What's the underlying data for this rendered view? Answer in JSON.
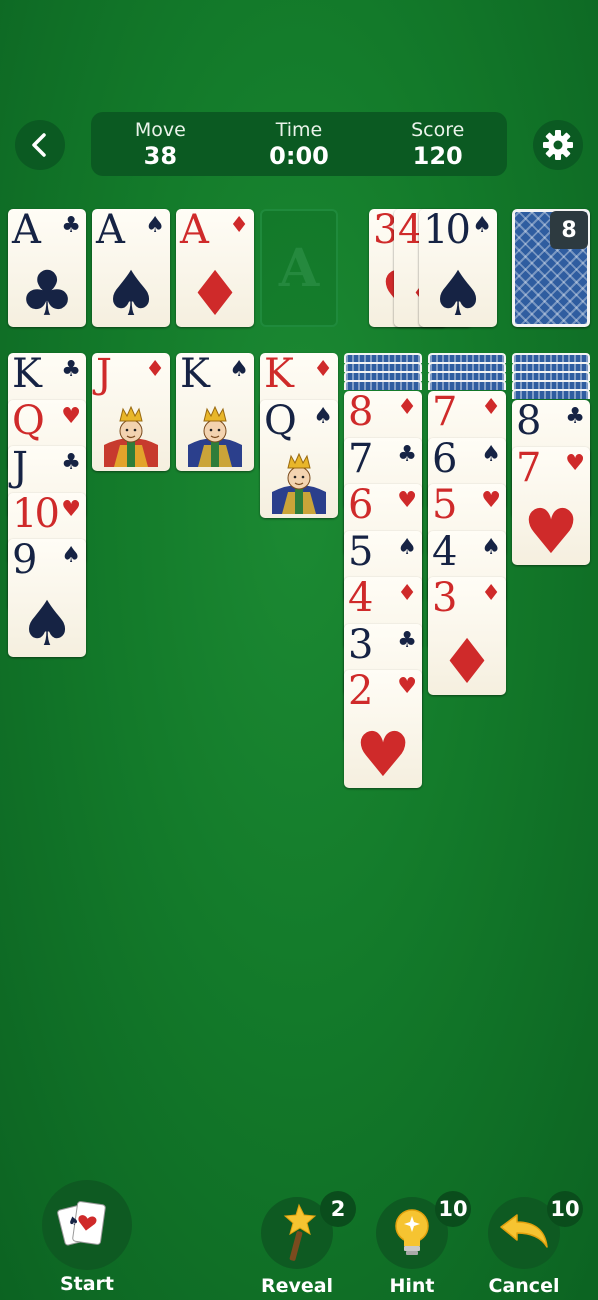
{
  "header": {
    "stats": {
      "move": {
        "label": "Move",
        "value": "38"
      },
      "time": {
        "label": "Time",
        "value": "0:00"
      },
      "score": {
        "label": "Score",
        "value": "120"
      }
    }
  },
  "foundations": [
    {
      "rank": "A",
      "suit": "♣"
    },
    {
      "rank": "A",
      "suit": "♠"
    },
    {
      "rank": "A",
      "suit": "♦"
    }
  ],
  "empty_foundation_label": "A",
  "waste": [
    {
      "rank": "3",
      "suit": "♥"
    },
    {
      "rank": "4",
      "suit": "♦"
    },
    {
      "rank": "10",
      "suit": "♠"
    }
  ],
  "stock": {
    "count": "8"
  },
  "tableau": [
    {
      "cards": [
        {
          "rank": "K",
          "suit": "♣"
        },
        {
          "rank": "Q",
          "suit": "♥"
        },
        {
          "rank": "J",
          "suit": "♣"
        },
        {
          "rank": "10",
          "suit": "♥"
        },
        {
          "rank": "9",
          "suit": "♠"
        }
      ]
    },
    {
      "cards": [
        {
          "rank": "J",
          "suit": "♦"
        }
      ]
    },
    {
      "cards": [
        {
          "rank": "K",
          "suit": "♠"
        }
      ]
    },
    {
      "cards": [
        {
          "rank": "K",
          "suit": "♦"
        },
        {
          "rank": "Q",
          "suit": "♠"
        }
      ]
    },
    {
      "cards": [
        {
          "rank": "8",
          "suit": "♦"
        },
        {
          "rank": "7",
          "suit": "♣"
        },
        {
          "rank": "6",
          "suit": "♥"
        },
        {
          "rank": "5",
          "suit": "♠"
        },
        {
          "rank": "4",
          "suit": "♦"
        },
        {
          "rank": "3",
          "suit": "♣"
        },
        {
          "rank": "2",
          "suit": "♥"
        }
      ]
    },
    {
      "cards": [
        {
          "rank": "7",
          "suit": "♦"
        },
        {
          "rank": "6",
          "suit": "♠"
        },
        {
          "rank": "5",
          "suit": "♥"
        },
        {
          "rank": "4",
          "suit": "♠"
        },
        {
          "rank": "3",
          "suit": "♦"
        }
      ]
    },
    {
      "cards": [
        {
          "rank": "8",
          "suit": "♣"
        },
        {
          "rank": "7",
          "suit": "♥"
        }
      ]
    }
  ],
  "toolbar": {
    "start": {
      "label": "Start"
    },
    "reveal": {
      "label": "Reveal",
      "badge": "2"
    },
    "hint": {
      "label": "Hint",
      "badge": "10"
    },
    "cancel": {
      "label": "Cancel",
      "badge": "10"
    }
  },
  "colors": {
    "red_suit": "#cf2a2a",
    "black_suit": "#162344",
    "felt": "#137a2a",
    "card_back": "#2f5da0"
  }
}
